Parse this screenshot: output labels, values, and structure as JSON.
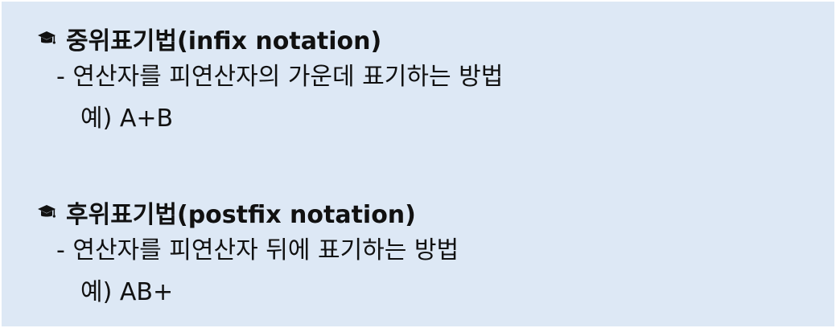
{
  "icon": "graduation-cap-icon",
  "colors": {
    "background": "#dde8f5",
    "text": "#111111"
  },
  "sections": [
    {
      "heading": "중위표기법(infix notation)",
      "description": "- 연산자를 피연산자의 가운데 표기하는 방법",
      "example": "예) A+B"
    },
    {
      "heading": "후위표기법(postfix notation)",
      "description": "- 연산자를 피연산자 뒤에 표기하는 방법",
      "example": "예) AB+"
    }
  ]
}
